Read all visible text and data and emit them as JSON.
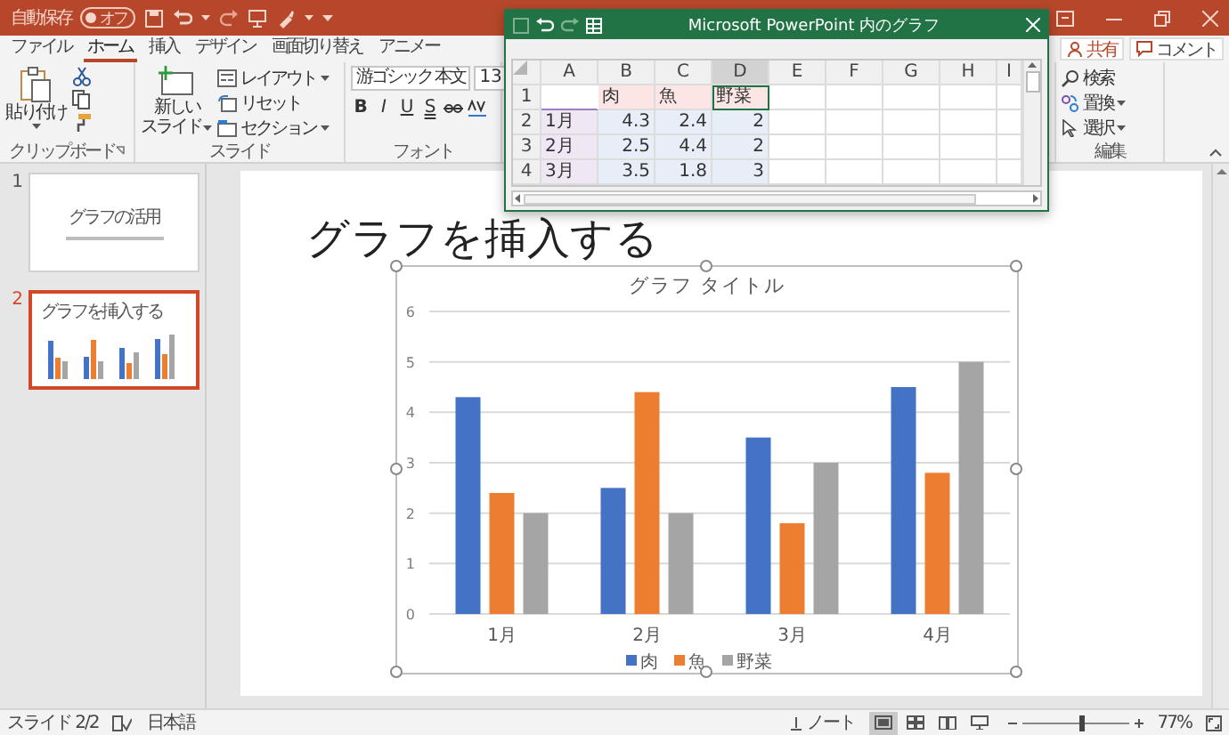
{
  "title_bar": {
    "autosave_label": "自動保存",
    "autosave_state": "オフ",
    "autosave_on": false
  },
  "ribbon_tabs": [
    {
      "label": "ファイル",
      "selected": false
    },
    {
      "label": "ホーム",
      "selected": true
    },
    {
      "label": "挿入",
      "selected": false
    },
    {
      "label": "デザイン",
      "selected": false
    },
    {
      "label": "画面切り替え",
      "selected": false
    },
    {
      "label": "アニメー",
      "selected": false
    }
  ],
  "share_button": "共有",
  "comment_button": "コメント",
  "clipboard_group": {
    "paste_button": "貼り付け",
    "label": "クリップボード"
  },
  "slides_group": {
    "new_slide_button": [
      "新しい",
      "スライド"
    ],
    "layout_button": "レイアウト",
    "reset_button": "リセット",
    "section_button": "セクション",
    "label": "スライド"
  },
  "font_group": {
    "font_name": "游ゴシック 本文",
    "font_size": "13",
    "style_buttons": [
      "B",
      "I",
      "U",
      "S"
    ],
    "label": "フォント"
  },
  "editing_group": {
    "buttons": [
      {
        "label": "検索",
        "kind": "search"
      },
      {
        "label": "置換",
        "kind": "replace"
      },
      {
        "label": "選択",
        "kind": "select"
      }
    ],
    "label": "編集"
  },
  "slide_thumbnails": [
    {
      "number": "1",
      "title": "グラフの活用",
      "kind": "title",
      "selected": false
    },
    {
      "number": "2",
      "title": "グラフを挿入する",
      "kind": "chart",
      "selected": true
    }
  ],
  "slide": {
    "title": "グラフを挿入する",
    "chart": {
      "chart_data": {
        "type": "bar",
        "title": "グラフ タイトル",
        "categories": [
          "1月",
          "2月",
          "3月",
          "4月"
        ],
        "series": [
          {
            "name": "肉",
            "color": "#4472c4",
            "values": [
              4.3,
              2.5,
              3.5,
              4.5
            ]
          },
          {
            "name": "魚",
            "color": "#ed7d31",
            "values": [
              2.4,
              4.4,
              1.8,
              2.8
            ]
          },
          {
            "name": "野菜",
            "color": "#a5a5a5",
            "values": [
              2,
              2,
              3,
              5
            ]
          }
        ],
        "ylim": [
          0,
          6
        ],
        "yticks": [
          0,
          1,
          2,
          3,
          4,
          5,
          6
        ],
        "grid": true,
        "legend": true
      }
    }
  },
  "datasheet": {
    "title": "Microsoft PowerPoint 内のグラフ",
    "columns": [
      {
        "label": "A",
        "selected": false
      },
      {
        "label": "B",
        "selected": false
      },
      {
        "label": "C",
        "selected": false
      },
      {
        "label": "D",
        "selected": true
      },
      {
        "label": "E",
        "selected": false
      },
      {
        "label": "F",
        "selected": false
      },
      {
        "label": "G",
        "selected": false
      },
      {
        "label": "H",
        "selected": false
      },
      {
        "label": "I",
        "selected": false
      }
    ],
    "header_row": {
      "number": "1",
      "series_names": [
        "肉",
        "魚",
        "野菜"
      ]
    },
    "rows": [
      {
        "number": "2",
        "category": "1月",
        "values": [
          "4.3",
          "2.4",
          "2"
        ]
      },
      {
        "number": "3",
        "category": "2月",
        "values": [
          "2.5",
          "4.4",
          "2"
        ]
      },
      {
        "number": "4",
        "category": "3月",
        "values": [
          "3.5",
          "1.8",
          "3"
        ]
      }
    ]
  },
  "status_bar": {
    "slide_indicator": "スライド 2/2",
    "language": "日本語",
    "notes_button": "ノート",
    "views": [
      {
        "kind": "normal",
        "selected": true
      },
      {
        "kind": "sorter",
        "selected": false
      },
      {
        "kind": "reading",
        "selected": false
      },
      {
        "kind": "slideshow",
        "selected": false
      }
    ],
    "zoom": "77%",
    "zoom_slider": {
      "level": 0.55
    }
  }
}
